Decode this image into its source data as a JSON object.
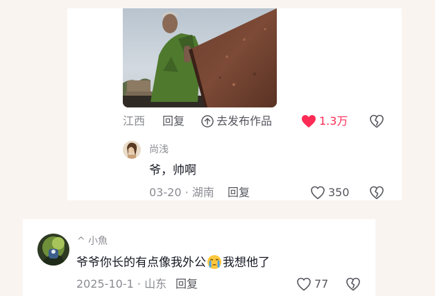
{
  "top_comment": {
    "location": "江西",
    "reply_label": "回复",
    "publish_label": "去发布作品",
    "like_count": "1.3万",
    "liked": true
  },
  "sub_reply": {
    "username": "尚浅",
    "text": "爷，帅啊",
    "date_location": "03-20 · 湖南",
    "reply_label": "回复",
    "like_count": "350"
  },
  "comment2": {
    "username": "^ 小魚",
    "text_before": "爷爷你长的有点像我外公",
    "emoji": "crying-face-emoji",
    "text_after": "我想他了",
    "date_location": "2025-10-1 · 山东",
    "reply_label": "回复",
    "like_count": "77"
  },
  "colors": {
    "background": "#faf4f1",
    "card": "#ffffff",
    "like_red": "#fe2c55",
    "meta_grey": "#8a8b91",
    "text": "#161823"
  }
}
